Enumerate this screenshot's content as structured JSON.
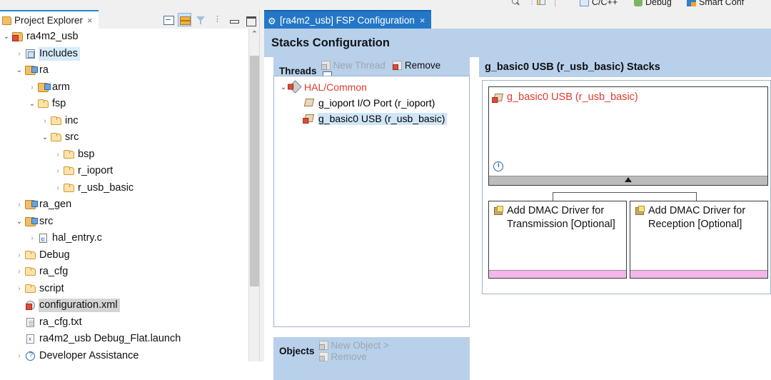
{
  "perspective_bar": {
    "items": [
      {
        "icon": "search-icon",
        "label": ""
      },
      {
        "icon": "dots-icon",
        "label": ""
      },
      {
        "icon": "open-perspective-icon",
        "label": ""
      },
      {
        "icon": "cpp-perspective-icon",
        "label": "C/C++"
      },
      {
        "icon": "debug-perspective-icon",
        "label": "Debug"
      },
      {
        "icon": "smart-configurator-icon",
        "label": "Smart Conf"
      }
    ]
  },
  "project_explorer": {
    "tab_label": "Project Explorer",
    "tab_close": "×",
    "toolbar": [
      {
        "name": "collapse-all-button",
        "selected": false
      },
      {
        "name": "link-with-editor-button",
        "selected": true
      },
      {
        "name": "view-filter-button",
        "selected": false
      },
      {
        "name": "view-menu-button",
        "selected": false,
        "glyph": "⋮"
      },
      {
        "name": "minimize-view-button",
        "selected": false
      },
      {
        "name": "maximize-view-button",
        "selected": false
      }
    ],
    "tree": [
      {
        "label": "ra4m2_usb",
        "depth": 0,
        "arrow": "open",
        "icon": "project-icon",
        "highlight": "none"
      },
      {
        "label": "Includes",
        "depth": 1,
        "arrow": "closed",
        "icon": "includes-icon",
        "highlight": "blue"
      },
      {
        "label": "ra",
        "depth": 1,
        "arrow": "open",
        "icon": "source-folder-icon",
        "highlight": "none"
      },
      {
        "label": "arm",
        "depth": 2,
        "arrow": "closed",
        "icon": "source-folder-icon",
        "highlight": "none"
      },
      {
        "label": "fsp",
        "depth": 2,
        "arrow": "open",
        "icon": "folder-icon",
        "highlight": "none"
      },
      {
        "label": "inc",
        "depth": 3,
        "arrow": "closed",
        "icon": "folder-icon",
        "highlight": "none"
      },
      {
        "label": "src",
        "depth": 3,
        "arrow": "open",
        "icon": "folder-icon",
        "highlight": "none"
      },
      {
        "label": "bsp",
        "depth": 4,
        "arrow": "closed",
        "icon": "folder-icon",
        "highlight": "none"
      },
      {
        "label": "r_ioport",
        "depth": 4,
        "arrow": "closed",
        "icon": "folder-icon",
        "highlight": "none"
      },
      {
        "label": "r_usb_basic",
        "depth": 4,
        "arrow": "closed",
        "icon": "folder-icon",
        "highlight": "none"
      },
      {
        "label": "ra_gen",
        "depth": 1,
        "arrow": "closed",
        "icon": "source-folder-icon",
        "highlight": "none"
      },
      {
        "label": "src",
        "depth": 1,
        "arrow": "open",
        "icon": "source-folder-icon",
        "highlight": "none"
      },
      {
        "label": "hal_entry.c",
        "depth": 2,
        "arrow": "closed",
        "icon": "c-file-icon",
        "highlight": "none"
      },
      {
        "label": "Debug",
        "depth": 1,
        "arrow": "closed",
        "icon": "folder-icon",
        "highlight": "none"
      },
      {
        "label": "ra_cfg",
        "depth": 1,
        "arrow": "closed",
        "icon": "folder-icon",
        "highlight": "none"
      },
      {
        "label": "script",
        "depth": 1,
        "arrow": "closed",
        "icon": "folder-icon",
        "highlight": "none"
      },
      {
        "label": "configuration.xml",
        "depth": 1,
        "arrow": "none",
        "icon": "xml-config-icon",
        "highlight": "gray"
      },
      {
        "label": "ra_cfg.txt",
        "depth": 1,
        "arrow": "none",
        "icon": "text-file-icon",
        "highlight": "none"
      },
      {
        "label": "ra4m2_usb Debug_Flat.launch",
        "depth": 1,
        "arrow": "none",
        "icon": "launch-file-icon",
        "highlight": "none"
      },
      {
        "label": "Developer Assistance",
        "depth": 1,
        "arrow": "closed",
        "icon": "help-icon",
        "highlight": "none"
      }
    ],
    "scrollbar": {
      "up_arrow": "⌃"
    }
  },
  "editor": {
    "tab_label": "[ra4m2_usb] FSP Configuration",
    "tab_close": "×",
    "tab_icon": "gear-icon",
    "gear_glyph": "⚙",
    "page_title": "Stacks Configuration",
    "threads": {
      "title": "Threads",
      "actions": [
        {
          "label": "New Thread",
          "icon": "new-thread-icon",
          "enabled": false
        },
        {
          "label": "Remove",
          "icon": "remove-icon",
          "enabled": true
        },
        {
          "label": "",
          "icon": "collapse-icon",
          "enabled": true
        }
      ],
      "tree": [
        {
          "label": "HAL/Common",
          "depth": 0,
          "arrow": "open",
          "icon": "hal-common-icon",
          "color": "red",
          "selected": false
        },
        {
          "label": "g_ioport I/O Port (r_ioport)",
          "depth": 1,
          "arrow": "none",
          "icon": "module-icon",
          "color": "black",
          "selected": false
        },
        {
          "label": "g_basic0 USB (r_usb_basic)",
          "depth": 1,
          "arrow": "none",
          "icon": "module-error-icon",
          "color": "black",
          "selected": true
        }
      ]
    },
    "objects": {
      "title": "Objects",
      "actions": [
        {
          "label": "New Object >",
          "icon": "new-object-icon",
          "enabled": false
        },
        {
          "label": "Remove",
          "icon": "remove-icon",
          "enabled": false
        }
      ]
    },
    "stacks": {
      "title": "g_basic0 USB (r_usb_basic) Stacks",
      "main_node": {
        "label": "g_basic0 USB (r_usb_basic)",
        "icon": "module-error-icon",
        "info_icon": "info-icon",
        "has_expand_caret": true,
        "color": "#e03a2f"
      },
      "child_nodes": [
        {
          "label": "Add DMAC Driver for Transmission [Optional]",
          "icon": "add-module-icon",
          "footer_color": "#f3b7ec"
        },
        {
          "label": "Add DMAC Driver for Reception [Optional]",
          "icon": "add-module-icon",
          "footer_color": "#f3b7ec"
        }
      ]
    }
  },
  "colors": {
    "tab_active_blue": "#2477c6",
    "header_band": "#b8d0ea",
    "selection_blue": "#cfe6f8",
    "error_red": "#e03a2f",
    "optional_pink": "#f3b7ec"
  }
}
